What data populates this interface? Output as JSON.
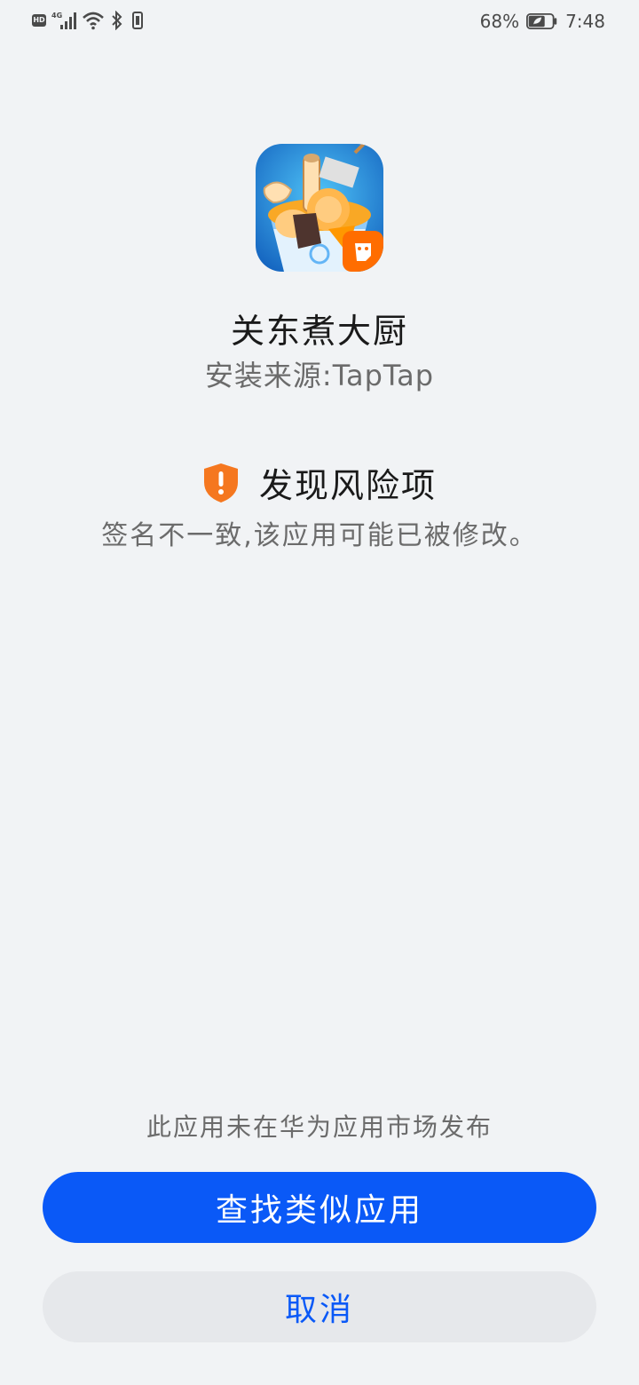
{
  "status_bar": {
    "hd_label": "HD",
    "network_label": "4G",
    "battery_percent": "68%",
    "time": "7:48"
  },
  "app": {
    "name": "关东煮大厨",
    "install_source": "安装来源:TapTap",
    "icon": "oden-game-icon"
  },
  "risk": {
    "icon": "warning-shield-icon",
    "title": "发现风险项",
    "description": "签名不一致,该应用可能已被修改。"
  },
  "footer": {
    "market_note": "此应用未在华为应用市场发布",
    "primary_button": "查找类似应用",
    "secondary_button": "取消"
  },
  "colors": {
    "background": "#f1f3f5",
    "primary": "#0a59f7",
    "warning": "#f5771f",
    "secondary_button_bg": "#e6e8eb"
  }
}
